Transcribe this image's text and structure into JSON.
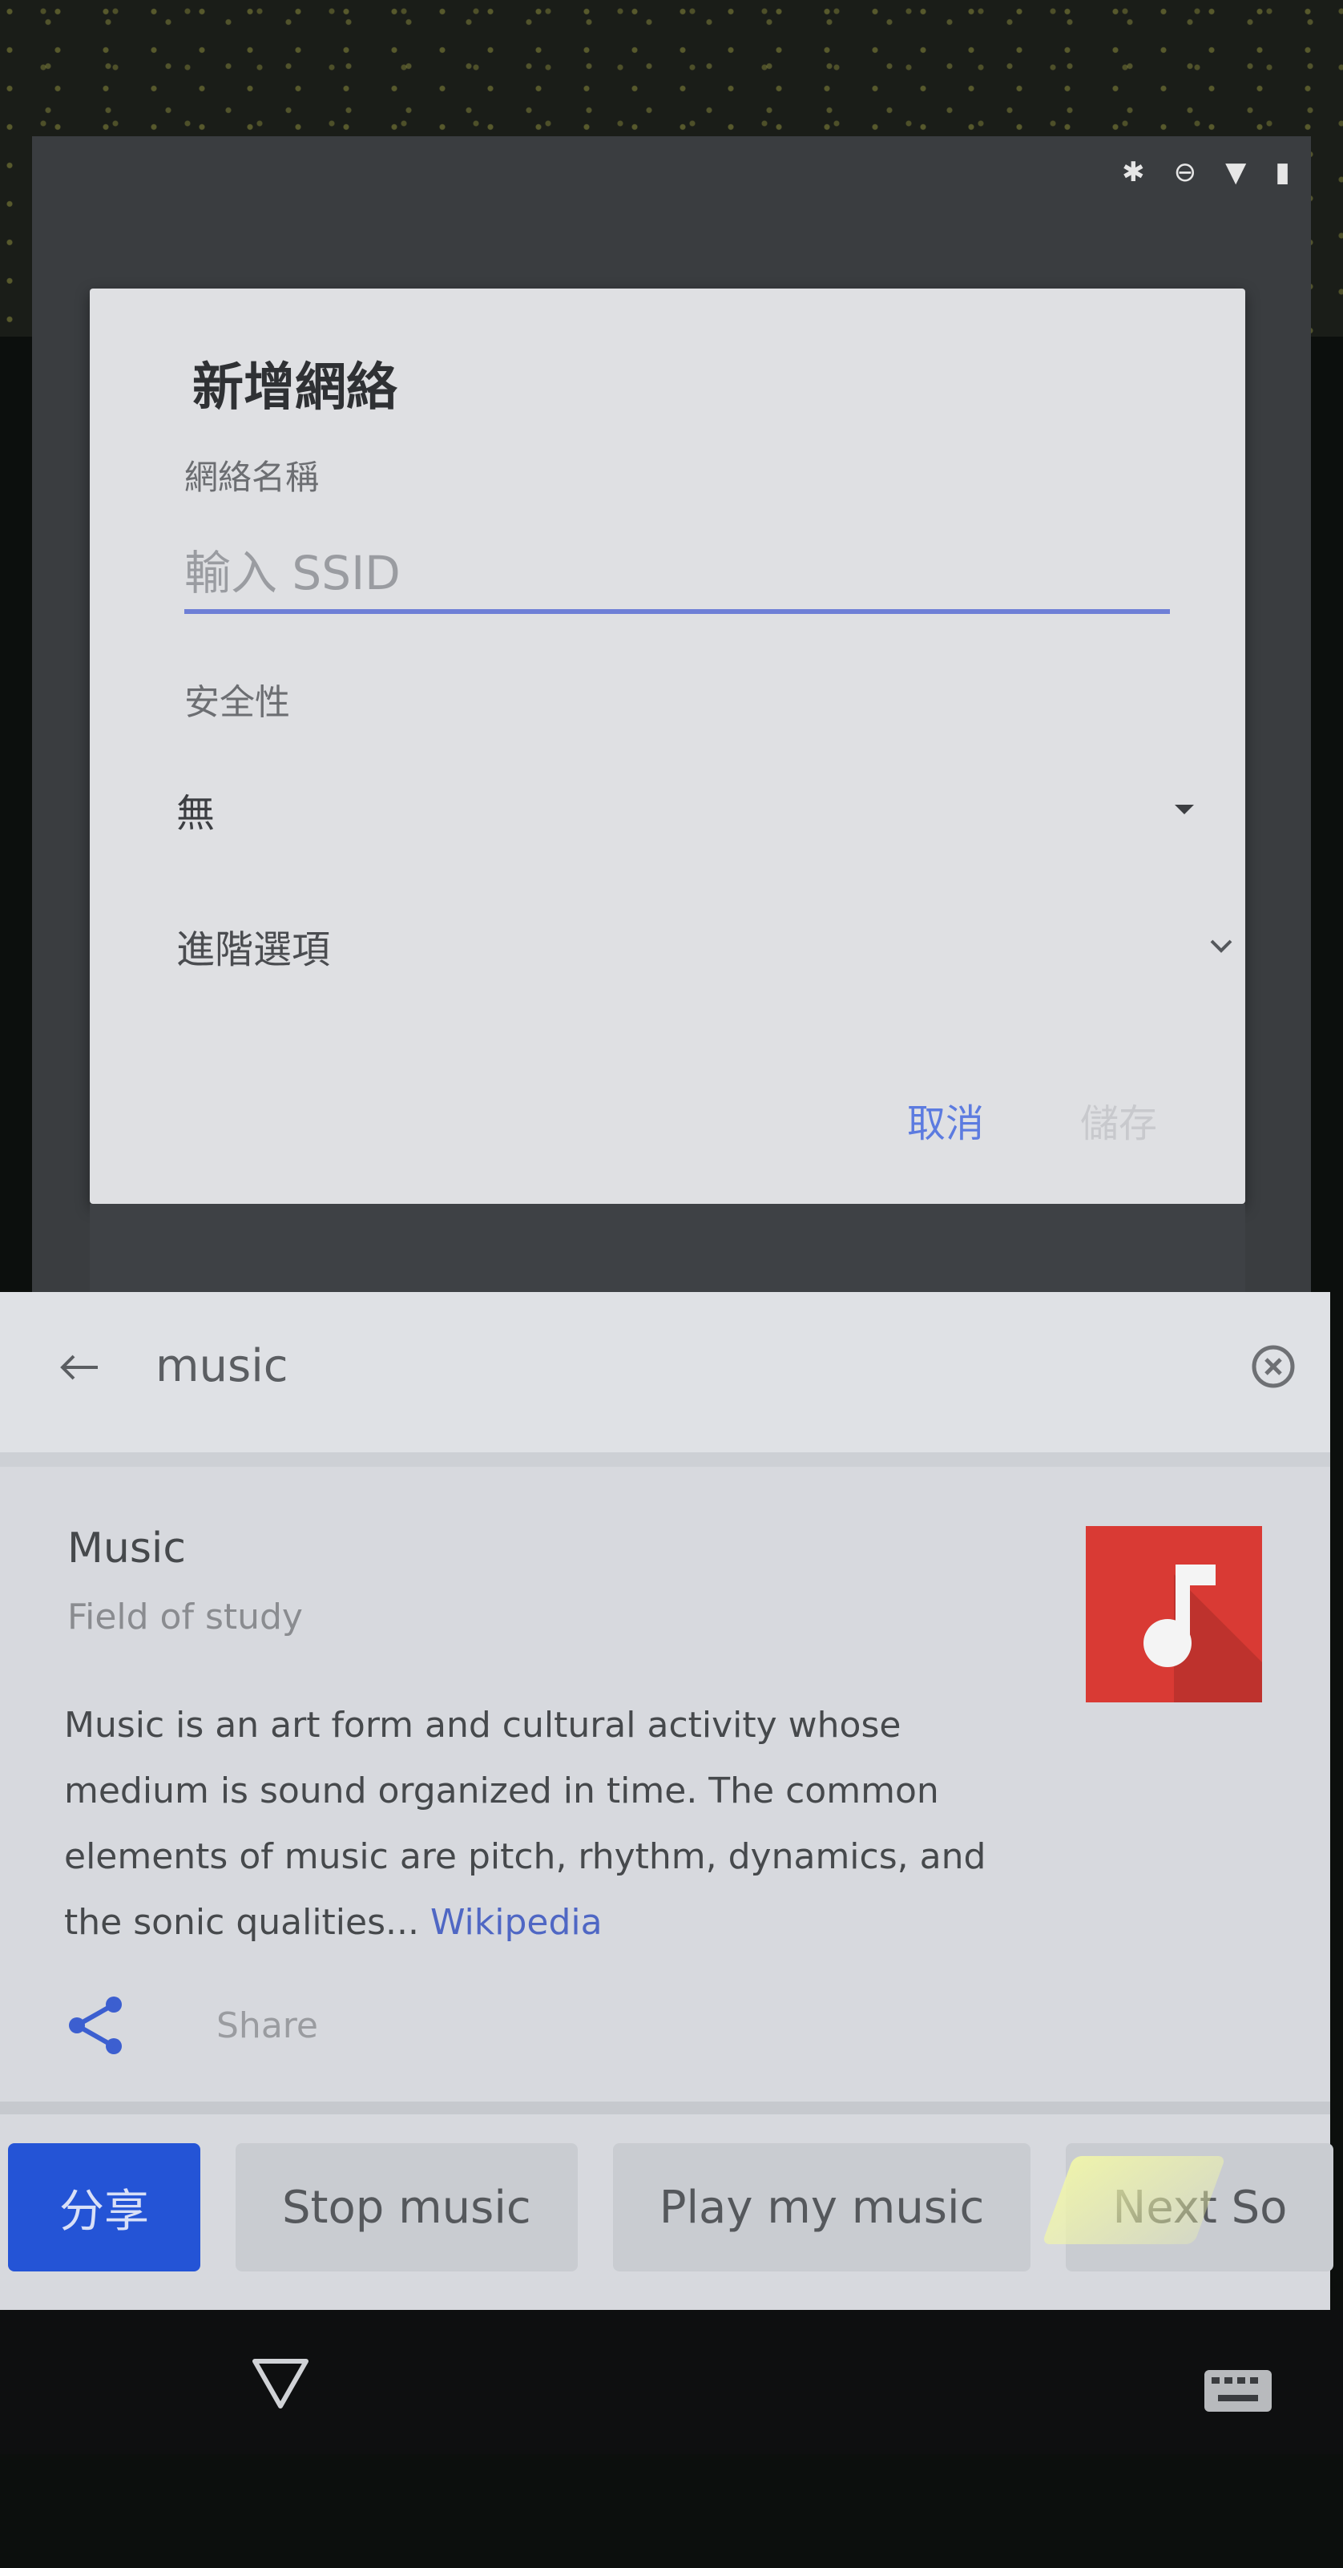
{
  "dialog": {
    "title": "新增網絡",
    "network_name_label": "網絡名稱",
    "ssid_placeholder": "輸入 SSID",
    "security_label": "安全性",
    "security_value": "無",
    "advanced_options_label": "進階選項",
    "cancel_label": "取消",
    "save_label": "儲存"
  },
  "search": {
    "query": "music"
  },
  "card": {
    "title": "Music",
    "subtitle": "Field of study",
    "description": "Music is an art form and cultural activity whose medium is sound organized in time. The common elements of music are pitch, rhythm, dynamics, and the sonic qualities...",
    "source_link": "Wikipedia",
    "share_label": "Share",
    "thumb_color": "#d93a34"
  },
  "chips": {
    "share": "分享",
    "stop_music": "Stop music",
    "play_my_music": "Play my music",
    "next_song": "Next So"
  },
  "colors": {
    "accent": "#5c7be0",
    "primary_chip": "#2454d6"
  }
}
